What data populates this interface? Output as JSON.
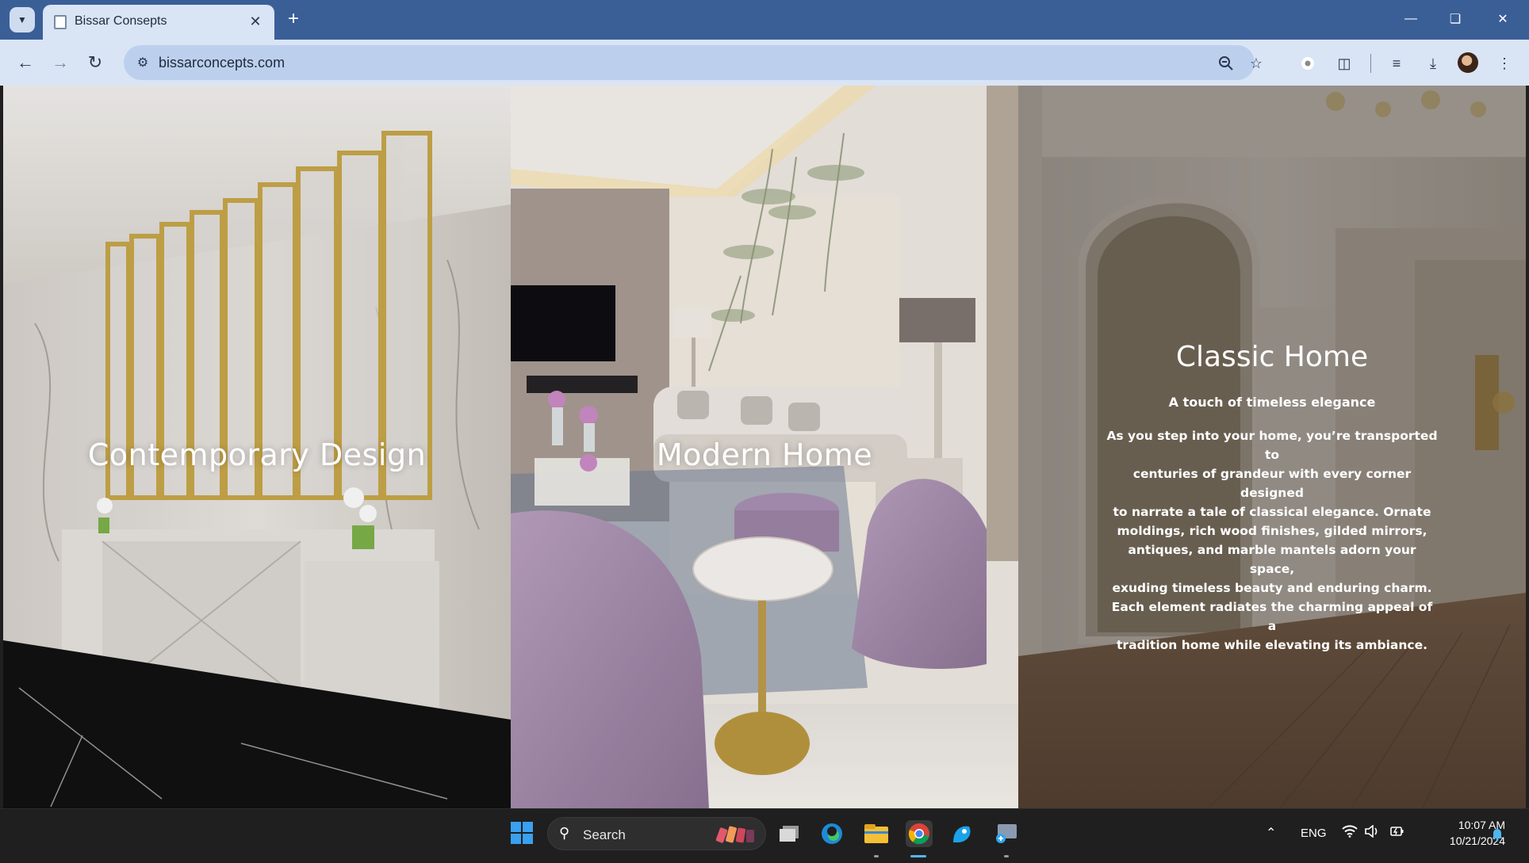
{
  "browser": {
    "tab": {
      "title": "Bissar Consepts"
    },
    "address_bar": {
      "url": "bissarconcepts.com"
    },
    "icons": {
      "tab_search": "chevron-down-icon",
      "close_tab": "close-icon",
      "new_tab": "plus-icon",
      "back": "arrow-left-icon",
      "forward": "arrow-right-icon",
      "reload": "reload-icon",
      "site_info": "tune-icon",
      "zoom": "zoom-out-icon",
      "bookmark": "star-icon",
      "extension": "puzzle-icon",
      "media": "media-queue-icon",
      "downloads": "download-icon",
      "menu": "kebab-menu-icon"
    },
    "colors": {
      "tabbar": "#3a5f97",
      "toolbar": "#d9e4f5",
      "omnibox": "#bcd0ee"
    }
  },
  "page": {
    "panels": [
      {
        "title": "Contemporary Design"
      },
      {
        "title": "Modern Home"
      },
      {
        "title": "Classic Home",
        "subtitle": "A touch of timeless elegance",
        "body_lines": [
          "As you step into your home, you’re transported to",
          "centuries of grandeur with every corner designed",
          "to narrate a tale of classical elegance. Ornate",
          "moldings, rich wood finishes, gilded mirrors,",
          "antiques, and marble mantels adorn your space,",
          "exuding timeless beauty and enduring charm.",
          "Each element radiates the charming appeal of a",
          "tradition home while elevating its ambiance."
        ]
      }
    ]
  },
  "taskbar": {
    "search_label": "Search",
    "language": "ENG",
    "time": "10:07 AM",
    "date": "10/21/2024",
    "apps": [
      "windows-start-icon",
      "task-view-icon",
      "edge-icon",
      "file-explorer-icon",
      "chrome-icon",
      "app-icon",
      "remote-desktop-icon"
    ],
    "colors": {
      "windows_blue": "#3aa0f0",
      "background": "#1f1f1f"
    }
  }
}
